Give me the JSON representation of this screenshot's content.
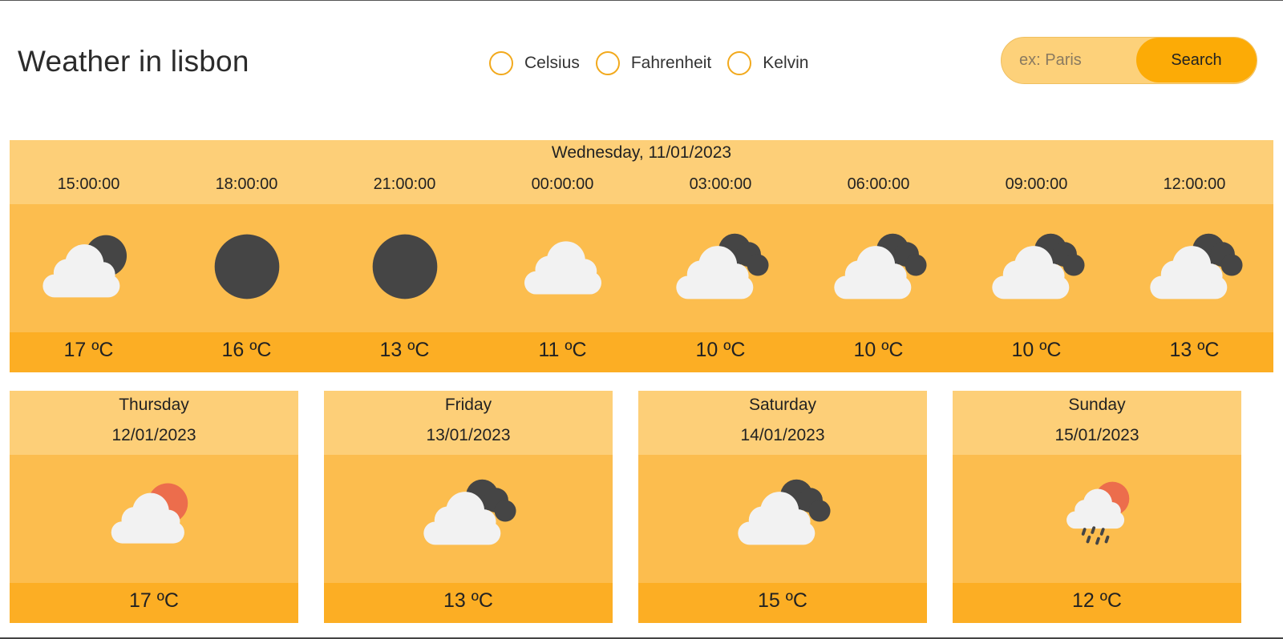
{
  "header": {
    "title": "Weather in lisbon"
  },
  "units": [
    {
      "label": "Celsius"
    },
    {
      "label": "Fahrenheit"
    },
    {
      "label": "Kelvin"
    }
  ],
  "search": {
    "placeholder": "ex: Paris",
    "value": "",
    "button_label": "Search"
  },
  "today": {
    "date": "Wednesday, 11/01/2023",
    "hours": [
      {
        "time": "15:00:00",
        "icon": "cloud-moon-icon",
        "temp": "17 ºC"
      },
      {
        "time": "18:00:00",
        "icon": "full-moon-icon",
        "temp": "16 ºC"
      },
      {
        "time": "21:00:00",
        "icon": "full-moon-icon",
        "temp": "13 ºC"
      },
      {
        "time": "00:00:00",
        "icon": "cloud-icon",
        "temp": "11 ºC"
      },
      {
        "time": "03:00:00",
        "icon": "cloud-dark-cloud-icon",
        "temp": "10 ºC"
      },
      {
        "time": "06:00:00",
        "icon": "cloud-dark-cloud-icon",
        "temp": "10 ºC"
      },
      {
        "time": "09:00:00",
        "icon": "cloud-dark-cloud-icon",
        "temp": "10 ºC"
      },
      {
        "time": "12:00:00",
        "icon": "cloud-dark-cloud-icon",
        "temp": "13 ºC"
      }
    ]
  },
  "forecast": [
    {
      "day": "Thursday",
      "date": "12/01/2023",
      "icon": "cloud-sun-icon",
      "temp": "17 ºC"
    },
    {
      "day": "Friday",
      "date": "13/01/2023",
      "icon": "cloud-dark-cloud-icon",
      "temp": "13 ºC"
    },
    {
      "day": "Saturday",
      "date": "14/01/2023",
      "icon": "cloud-dark-cloud-icon",
      "temp": "15 ºC"
    },
    {
      "day": "Sunday",
      "date": "15/01/2023",
      "icon": "rain-cloud-sun-icon",
      "temp": "12 ºC"
    }
  ],
  "colors": {
    "header_band": "#fdcf78",
    "middle_band": "#fcbd4e",
    "footer_band": "#fcae24",
    "accent": "#fcab06",
    "cloud": "#f2f2f2",
    "dark": "#454545",
    "sun": "#ec6d4c"
  }
}
